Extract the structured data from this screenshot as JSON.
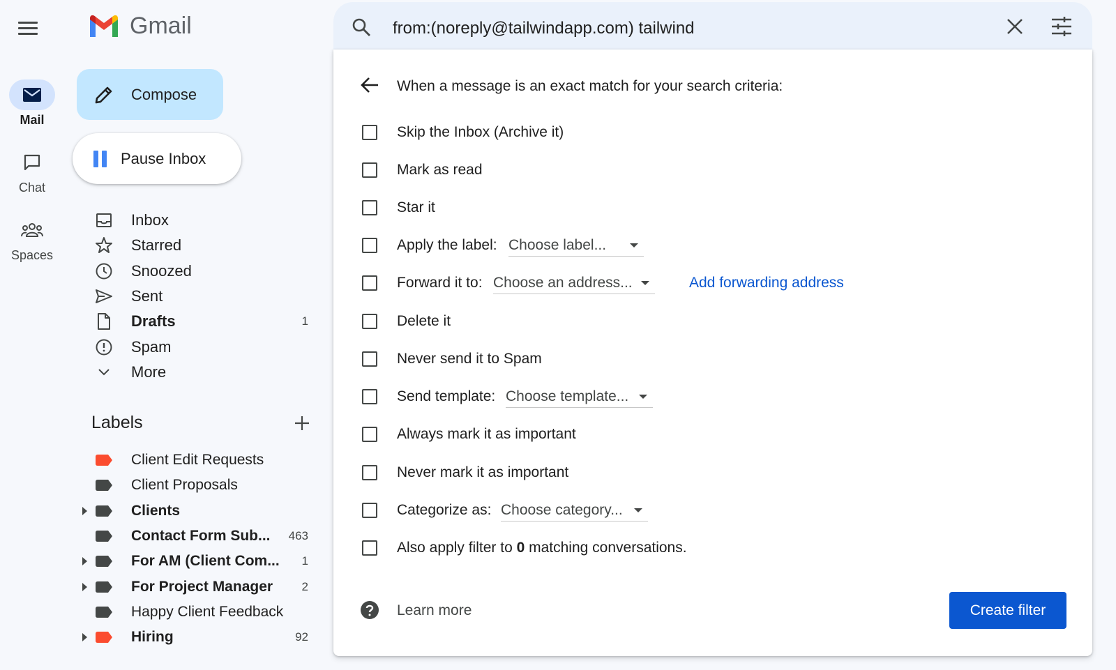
{
  "app": {
    "name": "Gmail"
  },
  "rail": {
    "items": [
      {
        "label": "Mail",
        "icon": "mail-icon",
        "active": true
      },
      {
        "label": "Chat",
        "icon": "chat-icon",
        "active": false
      },
      {
        "label": "Spaces",
        "icon": "spaces-icon",
        "active": false
      }
    ]
  },
  "nav": {
    "compose_label": "Compose",
    "pause_label": "Pause Inbox",
    "items": [
      {
        "label": "Inbox",
        "icon": "inbox-icon",
        "count": "",
        "bold": false
      },
      {
        "label": "Starred",
        "icon": "star-icon",
        "count": "",
        "bold": false
      },
      {
        "label": "Snoozed",
        "icon": "clock-icon",
        "count": "",
        "bold": false
      },
      {
        "label": "Sent",
        "icon": "send-icon",
        "count": "",
        "bold": false
      },
      {
        "label": "Drafts",
        "icon": "draft-icon",
        "count": "1",
        "bold": true
      },
      {
        "label": "Spam",
        "icon": "spam-icon",
        "count": "",
        "bold": false
      },
      {
        "label": "More",
        "icon": "chevron-down-icon",
        "count": "",
        "bold": false
      }
    ]
  },
  "labels": {
    "heading": "Labels",
    "items": [
      {
        "label": "Client Edit Requests",
        "color": "#fb4c2f",
        "count": "",
        "bold": false,
        "expandable": false
      },
      {
        "label": "Client Proposals",
        "color": "#444746",
        "count": "",
        "bold": false,
        "expandable": false
      },
      {
        "label": "Clients",
        "color": "#444746",
        "count": "",
        "bold": true,
        "expandable": true
      },
      {
        "label": "Contact Form Sub...",
        "color": "#444746",
        "count": "463",
        "bold": true,
        "expandable": false
      },
      {
        "label": "For AM (Client Com...",
        "color": "#444746",
        "count": "1",
        "bold": true,
        "expandable": true
      },
      {
        "label": "For Project Manager",
        "color": "#444746",
        "count": "2",
        "bold": true,
        "expandable": true
      },
      {
        "label": "Happy Client Feedback",
        "color": "#444746",
        "count": "",
        "bold": false,
        "expandable": false
      },
      {
        "label": "Hiring",
        "color": "#fb4c2f",
        "count": "92",
        "bold": true,
        "expandable": true
      }
    ]
  },
  "search": {
    "query": "from:(noreply@tailwindapp.com) tailwind"
  },
  "filter": {
    "heading": "When a message is an exact match for your search criteria:",
    "options": [
      {
        "label": "Skip the Inbox (Archive it)"
      },
      {
        "label": "Mark as read"
      },
      {
        "label": "Star it"
      },
      {
        "label": "Apply the label:",
        "dropdown": "Choose label..."
      },
      {
        "label": "Forward it to:",
        "dropdown": "Choose an address...",
        "link": "Add forwarding address"
      },
      {
        "label": "Delete it"
      },
      {
        "label": "Never send it to Spam"
      },
      {
        "label": "Send template:",
        "dropdown": "Choose template..."
      },
      {
        "label": "Always mark it as important"
      },
      {
        "label": "Never mark it as important"
      },
      {
        "label": "Categorize as:",
        "dropdown": "Choose category..."
      }
    ],
    "also_apply": {
      "prefix": "Also apply filter to ",
      "count": "0",
      "suffix": " matching conversations."
    },
    "learn_more": "Learn more",
    "create_label": "Create filter"
  },
  "colors": {
    "accent": "#0b57d0",
    "compose_bg": "#c2e7ff",
    "active_pill": "#d3e3fd",
    "label_red": "#fb4c2f"
  }
}
